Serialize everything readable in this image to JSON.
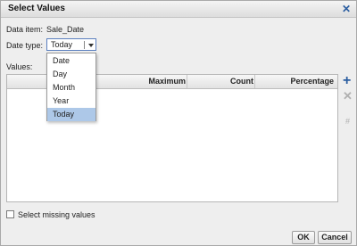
{
  "dialog": {
    "title": "Select Values",
    "close_label": "✕"
  },
  "data_item": {
    "label": "Data item:",
    "value": "Sale_Date"
  },
  "date_type": {
    "label": "Date type:",
    "selected": "Today",
    "options": [
      "Date",
      "Day",
      "Month",
      "Year",
      "Today"
    ]
  },
  "values": {
    "label": "Values:",
    "columns": [
      "Maximum",
      "Count",
      "Percentage"
    ]
  },
  "side_buttons": {
    "add": "+",
    "remove": "✕",
    "extra": "#"
  },
  "missing": {
    "label": "Select missing values",
    "checked": false
  },
  "buttons": {
    "ok": "OK",
    "cancel": "Cancel"
  }
}
